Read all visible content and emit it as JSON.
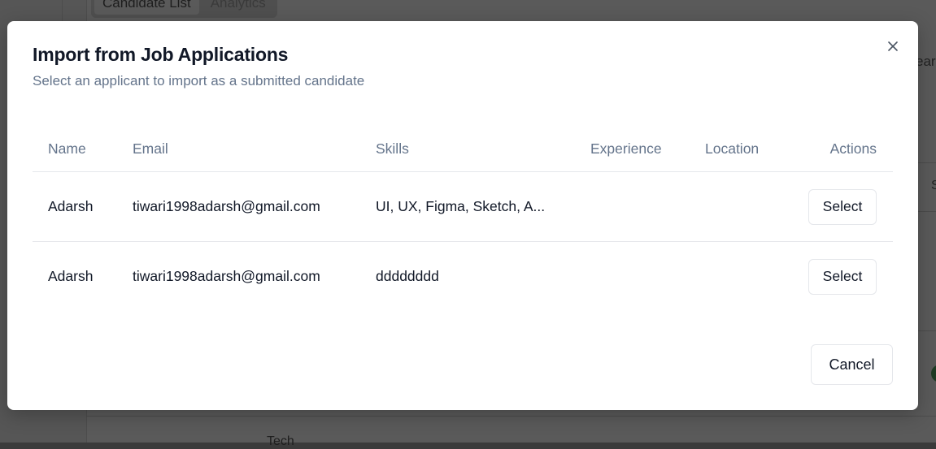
{
  "background": {
    "tabs": [
      "Candidate List",
      "Analytics"
    ],
    "right_fragment": "ear",
    "right_letter": "S",
    "bottom_fragment": "Tech"
  },
  "modal": {
    "title": "Import from Job Applications",
    "subtitle": "Select an applicant to import as a submitted candidate",
    "close_icon": "close-icon",
    "columns": {
      "name": "Name",
      "email": "Email",
      "skills": "Skills",
      "experience": "Experience",
      "location": "Location",
      "actions": "Actions"
    },
    "rows": [
      {
        "name": "Adarsh",
        "email": "tiwari1998adarsh@gmail.com",
        "skills": "UI, UX, Figma, Sketch, A...",
        "experience": "",
        "location": "",
        "action": "Select"
      },
      {
        "name": "Adarsh",
        "email": "tiwari1998adarsh@gmail.com",
        "skills": "dddddddd",
        "experience": "",
        "location": "",
        "action": "Select"
      }
    ],
    "cancel_label": "Cancel"
  },
  "colors": {
    "overlay": "#5a5a5a",
    "modal_bg": "#ffffff",
    "heading": "#111827",
    "muted_text": "#64748b",
    "border": "#e5e7eb"
  }
}
